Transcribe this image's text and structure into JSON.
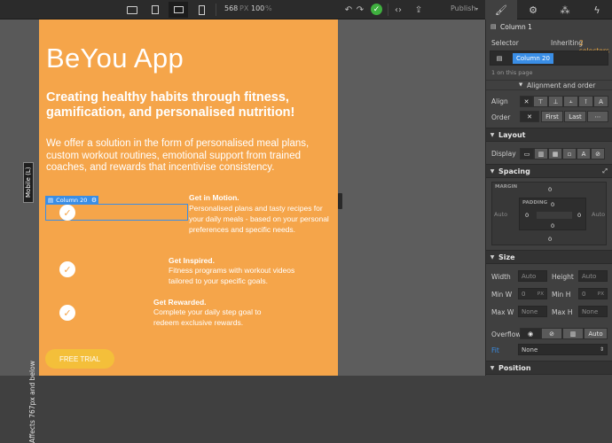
{
  "toolbar": {
    "width_value": "568",
    "width_unit": "PX",
    "zoom_value": "100",
    "zoom_unit": "%",
    "publish_label": "Publish",
    "publish_caret": "▾"
  },
  "canvas": {
    "side_label": "Affects 767px and below",
    "mobile_tag": "Mobile (L)",
    "selection_label": "Column 20",
    "selection_icon": "▤",
    "gear": "⚙"
  },
  "page": {
    "brand": "BeYou App",
    "headline": "Creating healthy habits through fitness, gamification, and personalised nutrition!",
    "intro": "We offer a solution in the form of personalised meal plans, custom workout routines, emotional support from trained coaches, and rewards that incentivise consistency.",
    "features": [
      {
        "title": "Get in Motion.",
        "desc": "Personalised plans and tasty recipes for your daily meals - based on your personal preferences and specific needs."
      },
      {
        "title": "Get Inspired.",
        "desc": "Fitness programs with workout videos tailored to your specific goals."
      },
      {
        "title": "Get Rewarded.",
        "desc": "Complete your daily step goal to redeem exclusive rewards."
      }
    ],
    "cta": "FREE TRIAL"
  },
  "panel": {
    "element_name": "Column 1",
    "selector_label": "Selector",
    "inheriting_text": "Inheriting",
    "inheriting_count": "2 selectors",
    "selector_value": "Column 20",
    "on_page": "1 on this page",
    "alignment_toggle": "Alignment and order",
    "align_label": "Align",
    "order_label": "Order",
    "order_first": "First",
    "order_last": "Last",
    "layout": {
      "title": "Layout",
      "display_label": "Display",
      "display_text_option": "A"
    },
    "spacing": {
      "title": "Spacing",
      "margin_label": "MARGIN",
      "padding_label": "PADDING",
      "margin_top": "0",
      "margin_bottom": "0",
      "margin_left": "Auto",
      "margin_right": "Auto",
      "padding_top": "0",
      "padding_bottom": "0",
      "padding_left": "0",
      "padding_right": "0"
    },
    "size": {
      "title": "Size",
      "width_label": "Width",
      "width_value": "Auto",
      "height_label": "Height",
      "height_value": "Auto",
      "minw_label": "Min W",
      "minw_value": "0",
      "minw_unit": "PX",
      "minh_label": "Min H",
      "minh_value": "0",
      "minh_unit": "PX",
      "maxw_label": "Max W",
      "maxw_value": "None",
      "maxh_label": "Max H",
      "maxh_value": "None",
      "overflow_label": "Overflow",
      "overflow_auto": "Auto",
      "fit_label": "Fit",
      "fit_value": "None"
    },
    "position": {
      "title": "Position"
    }
  },
  "colors": {
    "page_bg": "#f5a54a",
    "cta_bg": "#f4bf3a",
    "selection": "#3a8ee6",
    "publish_check": "#3fb03f",
    "inheriting_accent": "#e0a040"
  }
}
